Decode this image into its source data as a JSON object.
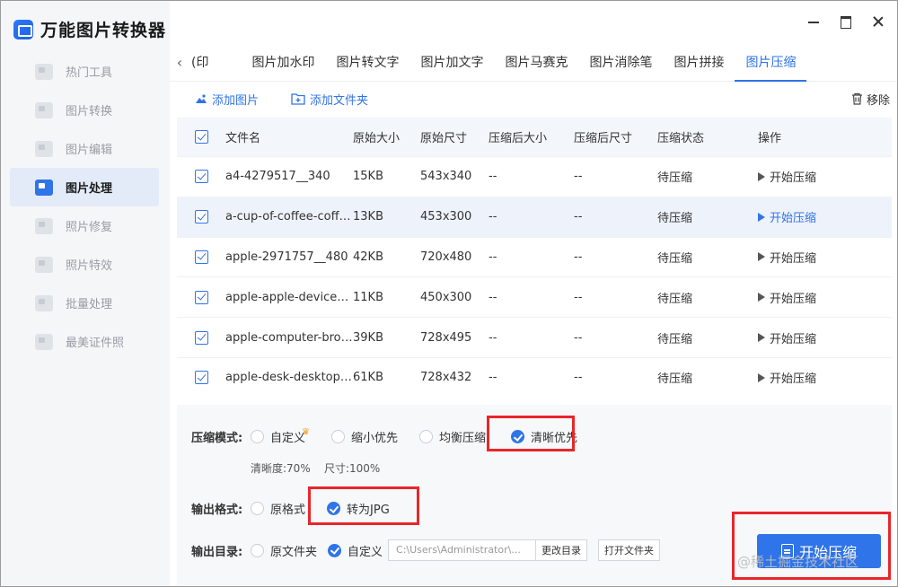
{
  "app": {
    "title": "万能图片转换器"
  },
  "sidebar": {
    "items": [
      {
        "label": "热门工具",
        "icon": "grid-icon",
        "active": false
      },
      {
        "label": "图片转换",
        "icon": "convert-icon",
        "active": false
      },
      {
        "label": "图片编辑",
        "icon": "edit-icon",
        "active": false
      },
      {
        "label": "图片处理",
        "icon": "process-icon",
        "active": true
      },
      {
        "label": "照片修复",
        "icon": "repair-icon",
        "active": false
      },
      {
        "label": "照片特效",
        "icon": "effect-icon",
        "active": false
      },
      {
        "label": "批量处理",
        "icon": "batch-icon",
        "active": false
      },
      {
        "label": "最美证件照",
        "icon": "id-photo-icon",
        "active": false
      }
    ]
  },
  "tabs": {
    "prev_arrow": "‹",
    "items": [
      "(印",
      "图片加水印",
      "图片转文字",
      "图片加文字",
      "图片马赛克",
      "图片消除笔",
      "图片拼接",
      "图片压缩"
    ],
    "active_index": 7
  },
  "toolbar": {
    "add_image": "添加图片",
    "add_folder": "添加文件夹",
    "remove": "移除"
  },
  "table": {
    "headers": [
      "文件名",
      "原始大小",
      "原始尺寸",
      "压缩后大小",
      "压缩后尺寸",
      "压缩状态",
      "操作"
    ],
    "rows": [
      {
        "name": "a4-4279517__340",
        "osize": "15KB",
        "odim": "543x340",
        "csize": "--",
        "cdim": "--",
        "status": "待压缩",
        "action": "开始压缩"
      },
      {
        "name": "a-cup-of-coffee-coffee...",
        "osize": "13KB",
        "odim": "453x300",
        "csize": "--",
        "cdim": "--",
        "status": "待压缩",
        "action": "开始压缩"
      },
      {
        "name": "apple-2971757__480",
        "osize": "42KB",
        "odim": "720x480",
        "csize": "--",
        "cdim": "--",
        "status": "待压缩",
        "action": "开始压缩"
      },
      {
        "name": "apple-apple-devices-cl...",
        "osize": "11KB",
        "odim": "450x300",
        "csize": "--",
        "cdim": "--",
        "status": "待压缩",
        "action": "开始压缩"
      },
      {
        "name": "apple-computer-brows...",
        "osize": "39KB",
        "odim": "728x495",
        "csize": "--",
        "cdim": "--",
        "status": "待压缩",
        "action": "开始压缩"
      },
      {
        "name": "apple-desk-desktop-i...",
        "osize": "61KB",
        "odim": "728x432",
        "csize": "--",
        "cdim": "--",
        "status": "待压缩",
        "action": "开始压缩"
      }
    ]
  },
  "settings": {
    "mode_label": "压缩模式:",
    "modes": [
      "自定义",
      "缩小优先",
      "均衡压缩",
      "清晰优先"
    ],
    "mode_selected": "清晰优先",
    "hint_clarity": "清晰度:70%",
    "hint_size": "尺寸:100%",
    "format_label": "输出格式:",
    "formats": [
      "原格式",
      "转为JPG"
    ],
    "format_selected": "转为JPG",
    "dir_label": "输出目录:",
    "dirs": [
      "原文件夹",
      "自定义"
    ],
    "dir_selected": "自定义",
    "path": "C:\\Users\\Administrator\\...",
    "change_dir": "更改目录",
    "open_folder": "打开文件夹"
  },
  "start_button": "开始压缩",
  "watermark": "@稀土掘金技术社区",
  "colors": {
    "accent": "#2f74e8",
    "highlight_border": "#e8262a"
  }
}
